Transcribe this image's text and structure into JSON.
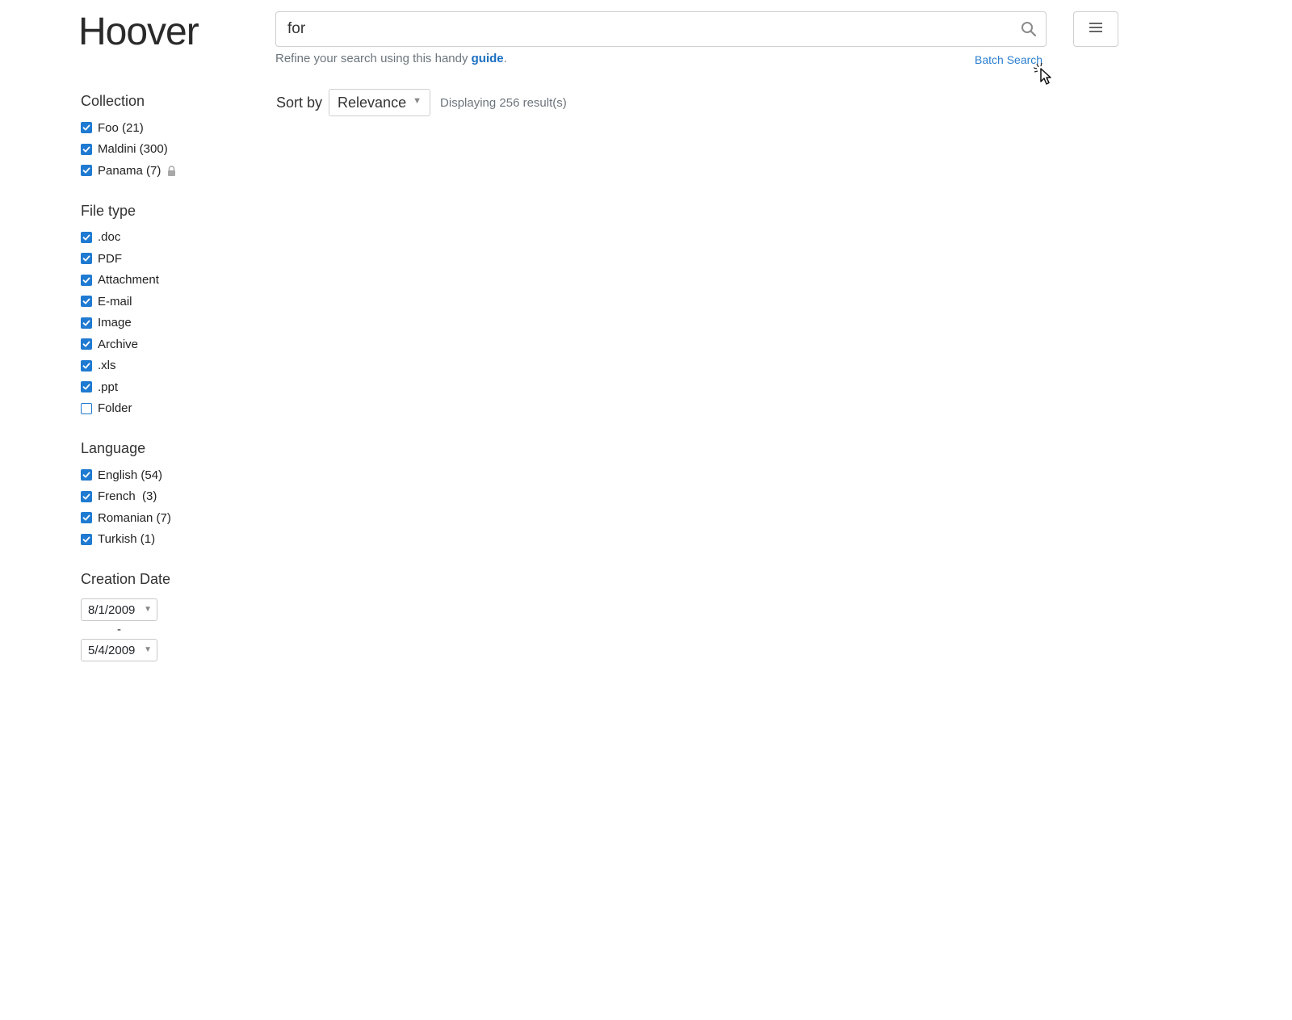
{
  "app": {
    "title": "Hoover"
  },
  "search": {
    "value": "for",
    "placeholder": ""
  },
  "guide": {
    "prefix": "Refine your search using this handy ",
    "link": "guide",
    "suffix": "."
  },
  "batch_search": {
    "label": "Batch Search"
  },
  "sort": {
    "label": "Sort by",
    "selected": "Relevance",
    "result_count": "Displaying 256 result(s)"
  },
  "facets": {
    "collection": {
      "title": "Collection",
      "items": [
        {
          "label": "Foo (21)",
          "checked": true
        },
        {
          "label": "Maldini (300)",
          "checked": true
        },
        {
          "label": "Panama (7)",
          "checked": true,
          "locked": true
        }
      ]
    },
    "file_type": {
      "title": "File type",
      "items": [
        {
          "label": ".doc",
          "checked": true
        },
        {
          "label": "PDF",
          "checked": true
        },
        {
          "label": "Attachment",
          "checked": true
        },
        {
          "label": "E-mail",
          "checked": true
        },
        {
          "label": "Image",
          "checked": true
        },
        {
          "label": "Archive",
          "checked": true
        },
        {
          "label": ".xls",
          "checked": true
        },
        {
          "label": ".ppt",
          "checked": true
        },
        {
          "label": "Folder",
          "checked": false
        }
      ]
    },
    "language": {
      "title": "Language",
      "items": [
        {
          "label": "English (54)",
          "checked": true
        },
        {
          "label": "French  (3)",
          "checked": true
        },
        {
          "label": "Romanian (7)",
          "checked": true
        },
        {
          "label": "Turkish (1)",
          "checked": true
        }
      ]
    },
    "creation_date": {
      "title": "Creation Date",
      "from": "8/1/2009",
      "separator": "-",
      "to": "5/4/2009"
    }
  },
  "colors": {
    "accent": "#1f7ad1",
    "link": "#2c7fd0"
  },
  "icons": {
    "search": "search-icon",
    "menu": "hamburger-menu-icon",
    "lock": "lock-icon",
    "cursor": "mouse-pointer-icon"
  }
}
